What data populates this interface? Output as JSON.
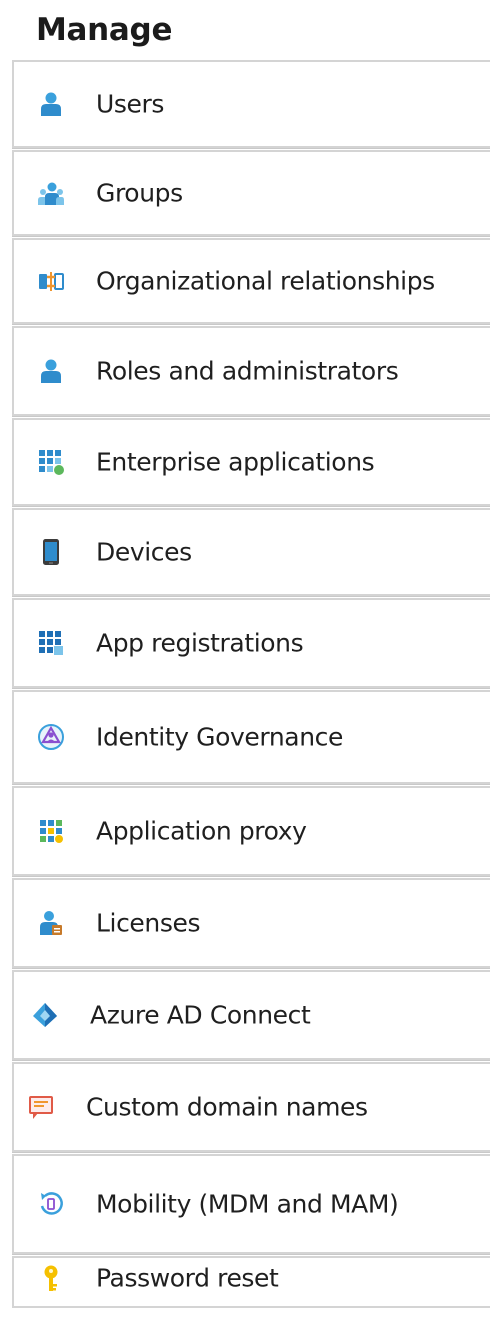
{
  "section": {
    "title": "Manage"
  },
  "menu": {
    "items": [
      {
        "label": "Users",
        "icon": "user-icon"
      },
      {
        "label": "Groups",
        "icon": "groups-icon"
      },
      {
        "label": "Organizational relationships",
        "icon": "organizational-relationships-icon"
      },
      {
        "label": "Roles and administrators",
        "icon": "roles-icon"
      },
      {
        "label": "Enterprise applications",
        "icon": "enterprise-apps-icon"
      },
      {
        "label": "Devices",
        "icon": "device-icon"
      },
      {
        "label": "App registrations",
        "icon": "app-registrations-icon"
      },
      {
        "label": "Identity Governance",
        "icon": "identity-governance-icon"
      },
      {
        "label": "Application proxy",
        "icon": "application-proxy-icon"
      },
      {
        "label": "Licenses",
        "icon": "licenses-icon"
      },
      {
        "label": "Azure AD Connect",
        "icon": "azure-ad-connect-icon"
      },
      {
        "label": "Custom domain names",
        "icon": "custom-domain-icon"
      },
      {
        "label": "Mobility (MDM and MAM)",
        "icon": "mobility-icon"
      },
      {
        "label": "Password reset",
        "icon": "key-icon"
      }
    ]
  },
  "colors": {
    "accent_blue": "#2f9bd6",
    "border": "#d4d4d4",
    "key_yellow": "#f5c000"
  }
}
